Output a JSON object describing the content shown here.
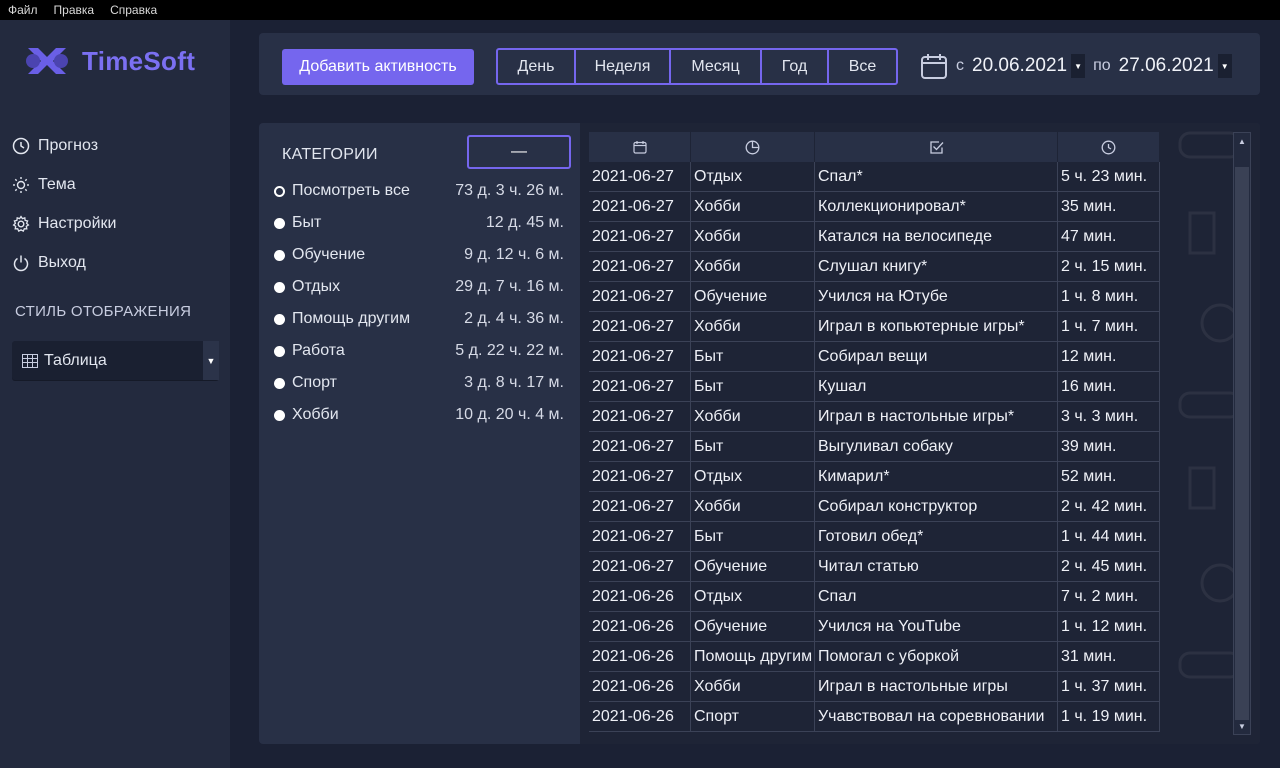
{
  "menu": [
    "Файл",
    "Правка",
    "Справка"
  ],
  "app": {
    "name": "TimeSoft",
    "brand_color": "#7566ee"
  },
  "nav": [
    {
      "label": "Прогноз",
      "icon": "clock-icon"
    },
    {
      "label": "Тема",
      "icon": "sun-icon"
    },
    {
      "label": "Настройки",
      "icon": "gear-icon"
    },
    {
      "label": "Выход",
      "icon": "power-icon"
    }
  ],
  "display_style": {
    "title": "СТИЛЬ ОТОБРАЖЕНИЯ",
    "selected": "Таблица",
    "icon": "table-icon"
  },
  "toolbar": {
    "add_label": "Добавить активность",
    "periods": [
      "День",
      "Неделя",
      "Месяц",
      "Год",
      "Все"
    ],
    "date_from_label": "с",
    "date_from": "20.06.2021",
    "date_to_label": "по",
    "date_to": "27.06.2021"
  },
  "categories": {
    "title": "КАТЕГОРИИ",
    "collapse_label": "—",
    "items": [
      {
        "name": "Посмотреть все",
        "total": "73 д. 3 ч. 26 м.",
        "selected": true
      },
      {
        "name": "Быт",
        "total": "12 д. 45 м."
      },
      {
        "name": "Обучение",
        "total": "9 д. 12 ч. 6 м."
      },
      {
        "name": "Отдых",
        "total": "29 д. 7 ч. 16 м."
      },
      {
        "name": "Помощь другим",
        "total": "2 д. 4 ч. 36 м."
      },
      {
        "name": "Работа",
        "total": "5 д. 22 ч. 22 м."
      },
      {
        "name": "Спорт",
        "total": "3 д. 8 ч. 17 м."
      },
      {
        "name": "Хобби",
        "total": "10 д. 20 ч. 4 м."
      }
    ]
  },
  "table": {
    "header_icons": [
      "calendar-icon",
      "pie-chart-icon",
      "checkbox-icon",
      "clock-icon"
    ],
    "rows": [
      [
        "2021-06-27",
        "Отдых",
        "Спал*",
        "5 ч. 23 мин."
      ],
      [
        "2021-06-27",
        "Хобби",
        "Коллекционировал*",
        "35 мин."
      ],
      [
        "2021-06-27",
        "Хобби",
        "Катался на велосипеде",
        "47 мин."
      ],
      [
        "2021-06-27",
        "Хобби",
        "Слушал книгу*",
        "2 ч. 15 мин."
      ],
      [
        "2021-06-27",
        "Обучение",
        "Учился на Ютубе",
        "1 ч. 8 мин."
      ],
      [
        "2021-06-27",
        "Хобби",
        "Играл в копьютерные игры*",
        "1 ч. 7 мин."
      ],
      [
        "2021-06-27",
        "Быт",
        "Собирал вещи",
        "12 мин."
      ],
      [
        "2021-06-27",
        "Быт",
        "Кушал",
        "16 мин."
      ],
      [
        "2021-06-27",
        "Хобби",
        "Играл в настольные игры*",
        "3 ч. 3 мин."
      ],
      [
        "2021-06-27",
        "Быт",
        "Выгуливал собаку",
        "39 мин."
      ],
      [
        "2021-06-27",
        "Отдых",
        "Кимарил*",
        "52 мин."
      ],
      [
        "2021-06-27",
        "Хобби",
        "Собирал конструктор",
        "2 ч. 42 мин."
      ],
      [
        "2021-06-27",
        "Быт",
        "Готовил обед*",
        "1 ч. 44 мин."
      ],
      [
        "2021-06-27",
        "Обучение",
        "Читал статью",
        "2 ч. 45 мин."
      ],
      [
        "2021-06-26",
        "Отдых",
        "Спал",
        "7 ч. 2 мин."
      ],
      [
        "2021-06-26",
        "Обучение",
        "Учился на YouTube",
        "1 ч. 12 мин."
      ],
      [
        "2021-06-26",
        "Помощь другим",
        "Помогал с уборкой",
        "31 мин."
      ],
      [
        "2021-06-26",
        "Хобби",
        "Играл в настольные игры",
        "1 ч. 37 мин."
      ],
      [
        "2021-06-26",
        "Спорт",
        "Учавствовал на соревновании",
        "1 ч. 19 мин."
      ]
    ]
  }
}
